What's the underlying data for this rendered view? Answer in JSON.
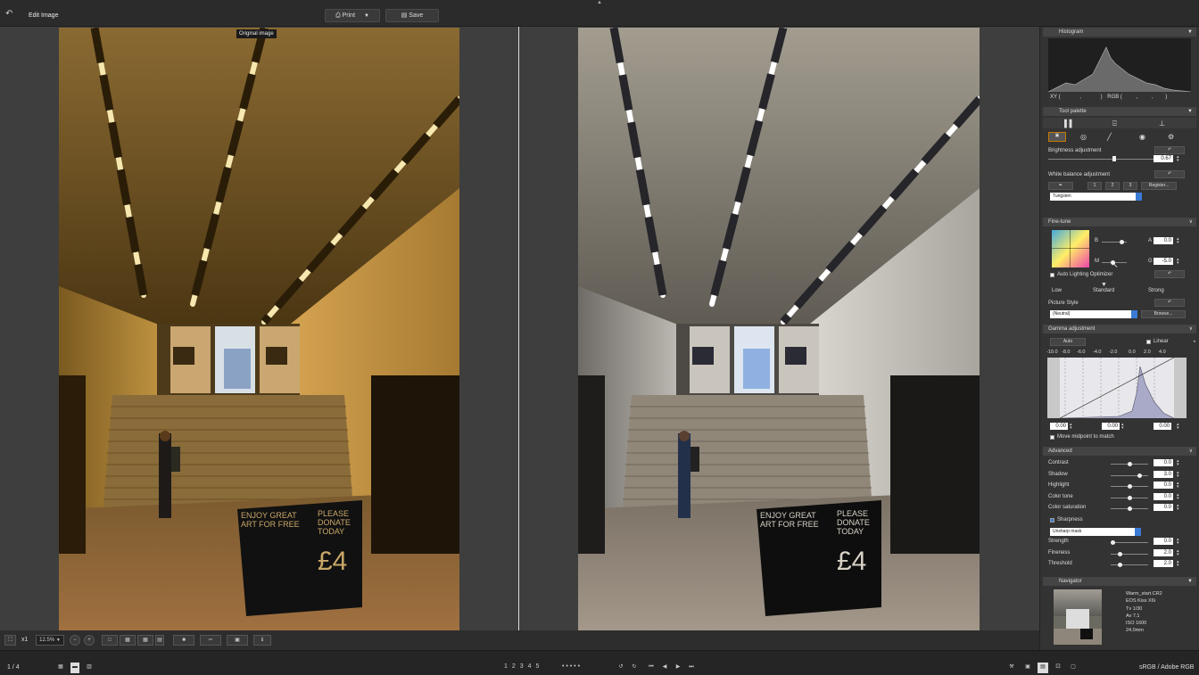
{
  "app": {
    "title": "Edit Image"
  },
  "toolbar": {
    "print_label": "Print",
    "save_label": "Save"
  },
  "viewer": {
    "original_label": "Original image"
  },
  "left_sign": {
    "line1": "ENJOY GREAT",
    "line2": "ART FOR FREE",
    "line3": "PLEASE",
    "line4": "DONATE",
    "line5": "TODAY",
    "price": "£4"
  },
  "right_sign": {
    "line1": "ENJOY GREAT",
    "line2": "ART FOR FREE",
    "line3": "PLEASE",
    "line4": "DONATE",
    "line5": "TODAY",
    "price": "£4"
  },
  "bottom": {
    "zoom_x": "x1",
    "zoom_value": "12.5%",
    "page_count": "1 / 4",
    "ratings": [
      "1",
      "2",
      "3",
      "4",
      "5"
    ],
    "color_profile": "sRGB / Adobe RGB"
  },
  "histogram": {
    "title": "Histogram",
    "xy_label": "XY (",
    "xy_sep1": ",",
    "xy_close": ")",
    "rgb_label": "RGB (",
    "rgb_sep1": ",",
    "rgb_sep2": ",",
    "rgb_close": ")"
  },
  "tool_palette": {
    "title": "Tool palette"
  },
  "brightness": {
    "label": "Brightness adjustment",
    "value": "0.67"
  },
  "white_balance": {
    "label": "White balance adjustment",
    "btn1": "1",
    "btn2": "2",
    "btn3": "3",
    "register": "Register...",
    "selected": "Tungsten"
  },
  "fine_tune": {
    "title": "Fine-tune",
    "b_label": "B",
    "a_label": "A",
    "a_value": "0.0",
    "m_label": "M",
    "g_label": "G",
    "g_value": "-5.0"
  },
  "alo": {
    "label": "Auto Lighting Optimizer",
    "low": "Low",
    "standard": "Standard",
    "strong": "Strong"
  },
  "picture_style": {
    "label": "Picture Style",
    "selected": "(Neutral)",
    "browse": "Browse..."
  },
  "gamma": {
    "title": "Gamma adjustment",
    "auto": "Auto",
    "linear": "Linear",
    "scale": [
      "-10.0",
      "-8.0",
      "-6.0",
      "-4.0",
      "-2.0",
      "0.0",
      "2.0",
      "4.0"
    ],
    "val1": "0.00",
    "val2": "0.00",
    "val3": "0.00",
    "midpoint": "Move midpoint to match"
  },
  "advanced": {
    "title": "Advanced",
    "rows": [
      {
        "label": "Contrast",
        "value": "0.0",
        "level": 0.5
      },
      {
        "label": "Shadow",
        "value": "3.0",
        "level": 0.8
      },
      {
        "label": "Highlight",
        "value": "0.0",
        "level": 0.5
      },
      {
        "label": "Color tone",
        "value": "0.0",
        "level": 0.5
      },
      {
        "label": "Color saturation",
        "value": "0.0",
        "level": 0.5
      }
    ]
  },
  "sharpness": {
    "label": "Sharpness",
    "mode": "Unsharp mask",
    "rows": [
      {
        "label": "Strength",
        "value": "0.0",
        "level": 0.0
      },
      {
        "label": "Fineness",
        "value": "2.0",
        "level": 0.2
      },
      {
        "label": "Threshold",
        "value": "2.0",
        "level": 0.2
      }
    ]
  },
  "navigator": {
    "title": "Navigator",
    "info": [
      "Warm_start.CR2",
      "EOS Kiss X6i",
      "Tv 1/30",
      "Av 7.1",
      "ISO 1600",
      "24.0mm"
    ]
  },
  "colors": {
    "accent": "#3a7bd5",
    "warm_tint": "#b88a3c",
    "cool_tint": "#9c9a93"
  }
}
